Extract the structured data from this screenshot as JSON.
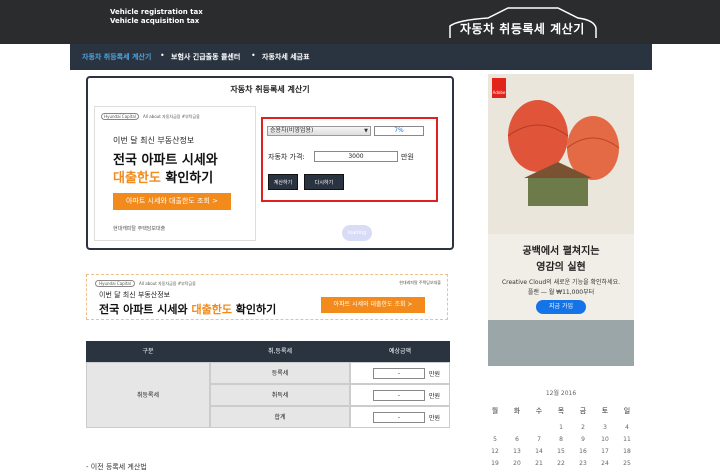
{
  "header": {
    "sub1": "Vehicle registration tax",
    "sub2": "Vehicle acquisition tax",
    "logo_text": "자동차 취등록세 계산기"
  },
  "nav": [
    "자동차 취등록세 계산기",
    "보험사 긴급출동 콜센터",
    "자동차세 세금표"
  ],
  "calculator": {
    "title": "자동차 취등록세 계산기",
    "vehicle_type": "승용차(비영업용)",
    "rate": "7%",
    "price_label": "자동차 가격:",
    "price_value": "3000",
    "price_unit": "만원",
    "calc_button": "계산하기",
    "reset_button": "다시하기",
    "loading": "loading"
  },
  "ad_square": {
    "brand": "Hyundai Capital",
    "brand_sub": "All about 자동차금융 #부탁금융",
    "line1": "이번 달 최신 부동산정보",
    "line2": "전국 아파트 시세와",
    "line3_hl": "대출한도",
    "line3_rest": " 확인하기",
    "button": "아파트 시세와 대출한도 조회 >",
    "footer": "현대캐피탈 주택담보대출"
  },
  "ad_banner": {
    "brand": "Hyundai Capital",
    "brand_sub": "All about 자동차금융 #부탁금융",
    "right": "현대캐피탈 주택담보대출",
    "line1": "이번 달 최신 부동산정보",
    "line2_a": "전국 아파트 시세와 ",
    "line2_hl": "대출한도",
    "line2_b": " 확인하기",
    "button": "아파트 시세와 대출한도 조회 >"
  },
  "result_table": {
    "headers": [
      "구분",
      "취,등록세",
      "예상금액"
    ],
    "group": "취등록세",
    "rows": [
      {
        "label": "등록세",
        "value": "-",
        "unit": "만원"
      },
      {
        "label": "취득세",
        "value": "-",
        "unit": "만원"
      },
      {
        "label": "합계",
        "value": "-",
        "unit": "만원"
      }
    ]
  },
  "bottom_link": "- 이전 등록세 계산법",
  "ad_side": {
    "brand": "Adobe",
    "headline1": "공백에서 펼쳐지는",
    "headline2": "영감의 실현",
    "text1": "Creative Cloud의 새로운 기능을 확인하세요.",
    "text2": "플랜 — 월 ₩11,000부터",
    "button": "지금 가입"
  },
  "calendar": {
    "title": "12월 2016",
    "weekdays": [
      "월",
      "화",
      "수",
      "목",
      "금",
      "토",
      "일"
    ],
    "weeks": [
      [
        "",
        "",
        "",
        "1",
        "2",
        "3",
        "4"
      ],
      [
        "5",
        "6",
        "7",
        "8",
        "9",
        "10",
        "11"
      ],
      [
        "12",
        "13",
        "14",
        "15",
        "16",
        "17",
        "18"
      ],
      [
        "19",
        "20",
        "21",
        "22",
        "23",
        "24",
        "25"
      ]
    ]
  },
  "colors": {
    "dark": "#2a3440",
    "accent_orange": "#f28a1c",
    "nav_active": "#4da3e0",
    "highlight_red": "#e02020",
    "adobe_red": "#e2231a",
    "adobe_blue": "#1473e6"
  }
}
